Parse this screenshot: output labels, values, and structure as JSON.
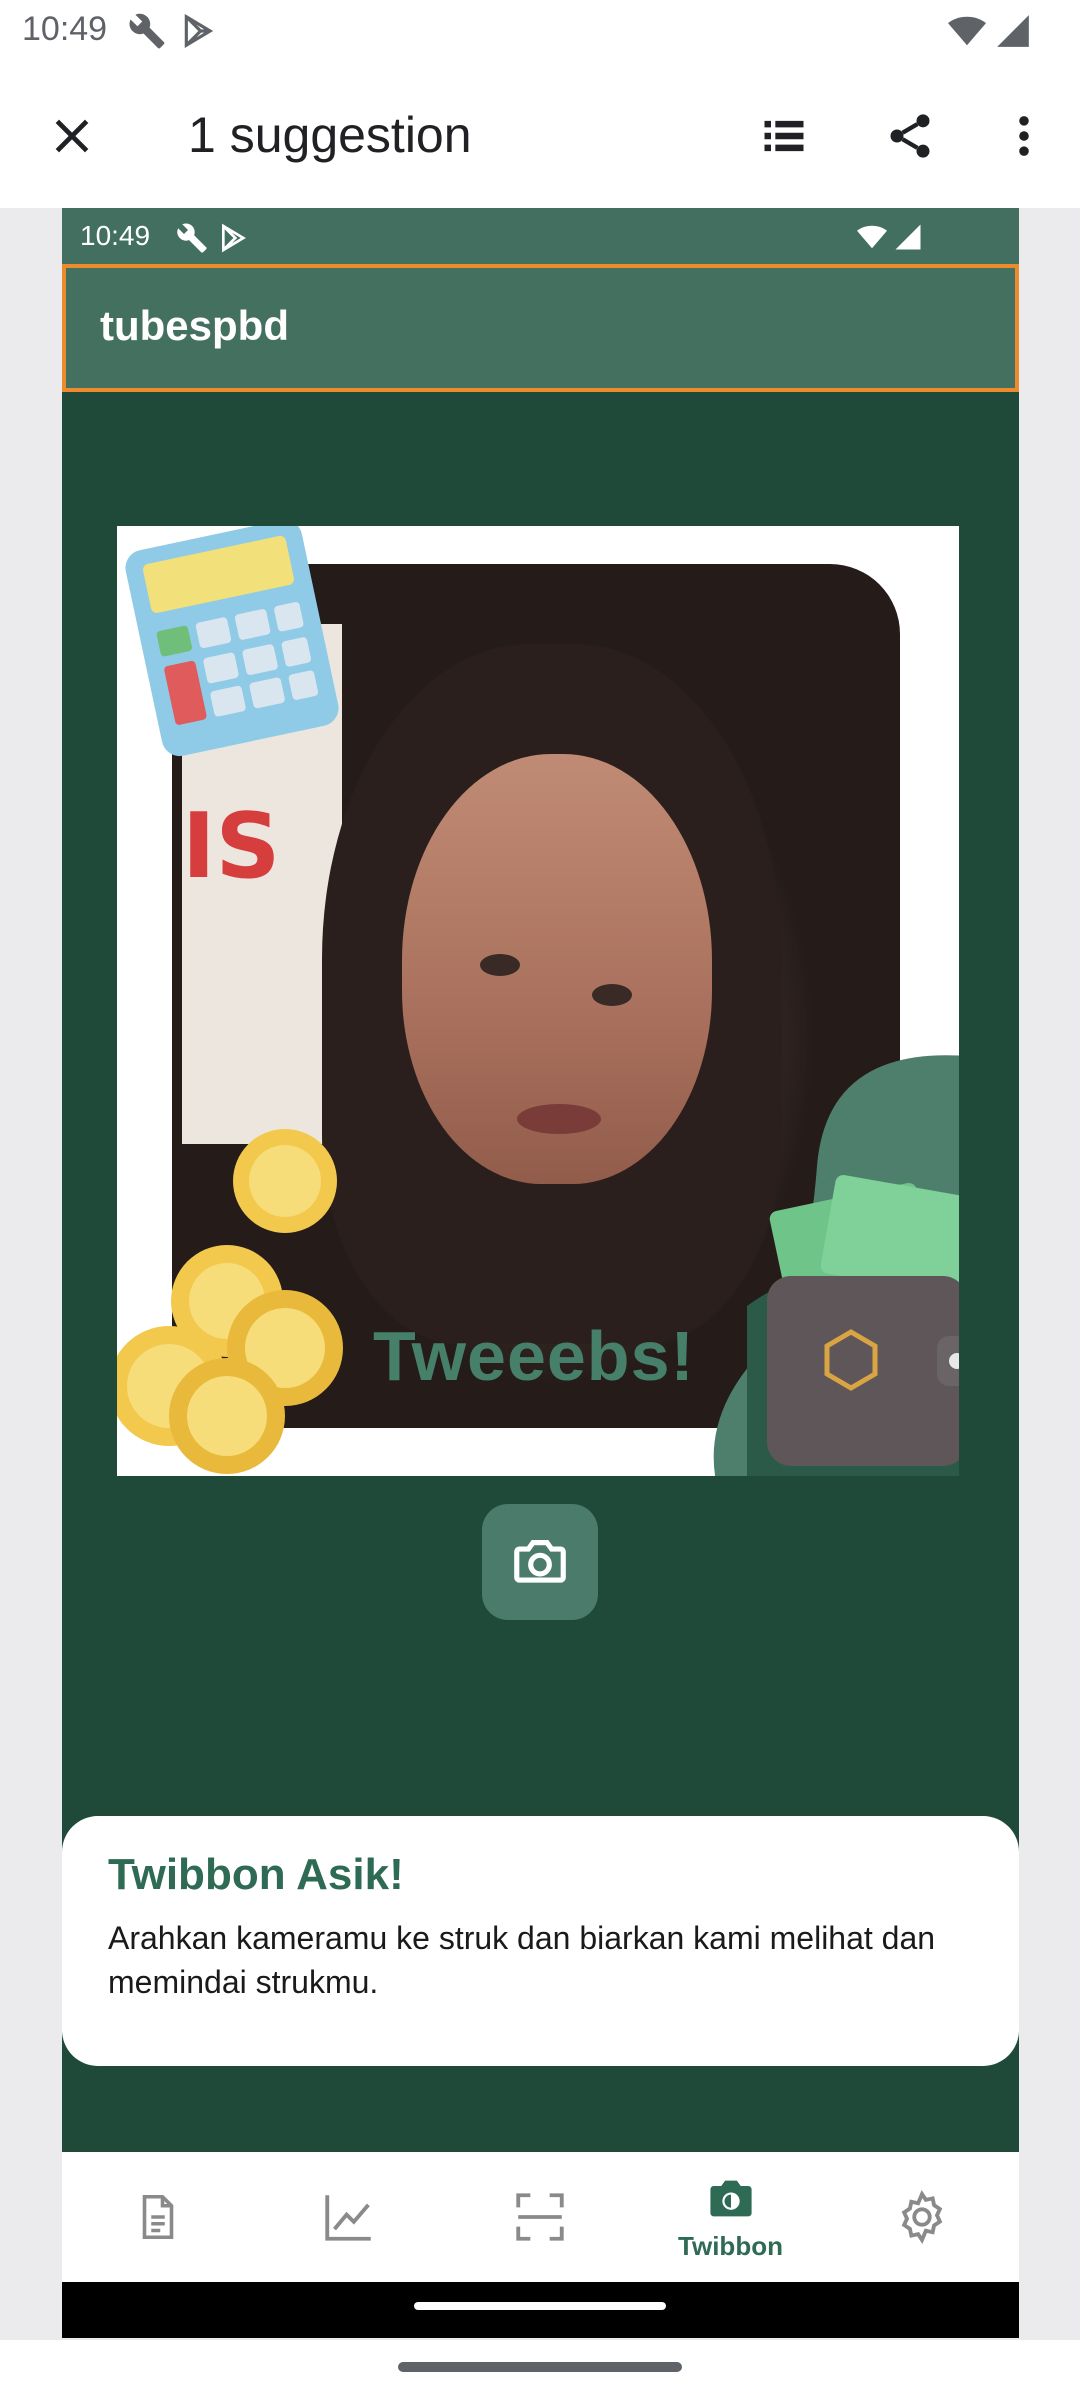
{
  "status_bar": {
    "time": "10:49",
    "icons": [
      "wrench-icon",
      "play-store-icon",
      "wifi-icon",
      "signal-icon"
    ]
  },
  "app_bar": {
    "title": "1 suggestion",
    "close_icon": "close-icon",
    "actions": [
      "list-icon",
      "share-icon",
      "more-vert-icon"
    ]
  },
  "inner_screen": {
    "status_time": "10:49",
    "app_title": "tubespbd",
    "twibbon_text": "Tweeebs!",
    "twibbon_poster_text": "IS",
    "camera_icon": "camera-icon",
    "card": {
      "title": "Twibbon Asik!",
      "body": "Arahkan kameramu ke struk dan biarkan kami melihat dan memindai strukmu."
    },
    "bottom_nav": {
      "items": [
        {
          "icon": "document-icon",
          "label": ""
        },
        {
          "icon": "chart-icon",
          "label": ""
        },
        {
          "icon": "scan-icon",
          "label": ""
        },
        {
          "icon": "twibbon-camera-icon",
          "label": "Twibbon"
        },
        {
          "icon": "settings-icon",
          "label": ""
        }
      ],
      "active_index": 3
    }
  },
  "colors": {
    "inner_background": "#1f4a39",
    "inner_appbar": "#44705f",
    "highlight_border": "#ed8a2b",
    "accent_green": "#2f6a55"
  }
}
